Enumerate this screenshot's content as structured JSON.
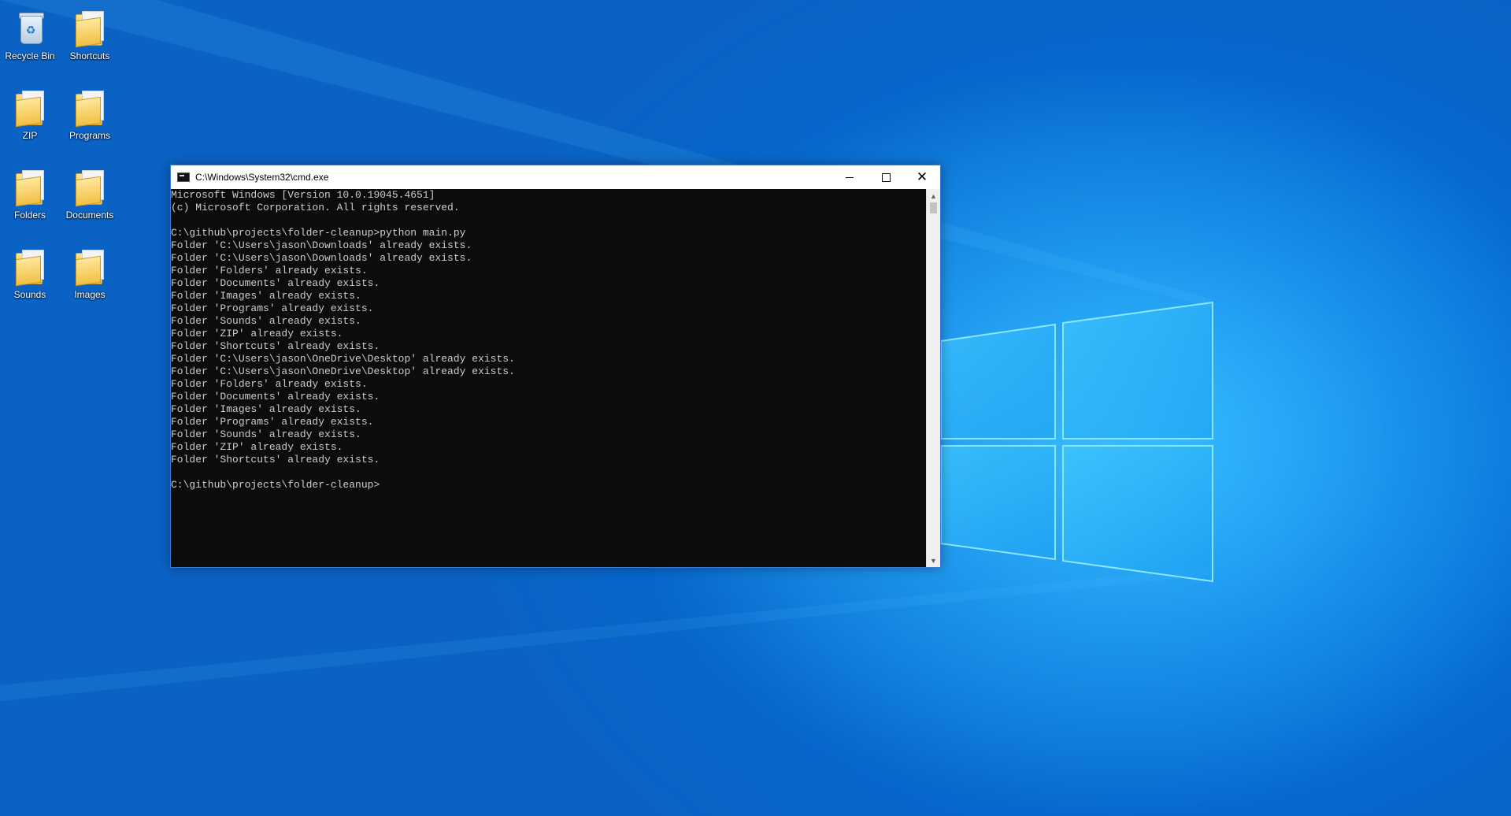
{
  "desktop": {
    "icons": [
      {
        "label": "Recycle Bin",
        "icon": "recycle-bin-icon"
      },
      {
        "label": "Shortcuts",
        "icon": "folder-icon"
      },
      {
        "label": "ZIP",
        "icon": "folder-icon"
      },
      {
        "label": "Programs",
        "icon": "folder-icon"
      },
      {
        "label": "Folders",
        "icon": "folder-icon"
      },
      {
        "label": "Documents",
        "icon": "folder-icon"
      },
      {
        "label": "Sounds",
        "icon": "folder-icon"
      },
      {
        "label": "Images",
        "icon": "folder-icon"
      }
    ]
  },
  "window": {
    "title": "C:\\Windows\\System32\\cmd.exe",
    "colors": {
      "console_bg": "#0c0c0c",
      "console_fg": "#cccccc",
      "titlebar_bg": "#ffffff"
    }
  },
  "console": {
    "lines": [
      "Microsoft Windows [Version 10.0.19045.4651]",
      "(c) Microsoft Corporation. All rights reserved.",
      "",
      "C:\\github\\projects\\folder-cleanup>python main.py",
      "Folder 'C:\\Users\\jason\\Downloads' already exists.",
      "Folder 'C:\\Users\\jason\\Downloads' already exists.",
      "Folder 'Folders' already exists.",
      "Folder 'Documents' already exists.",
      "Folder 'Images' already exists.",
      "Folder 'Programs' already exists.",
      "Folder 'Sounds' already exists.",
      "Folder 'ZIP' already exists.",
      "Folder 'Shortcuts' already exists.",
      "Folder 'C:\\Users\\jason\\OneDrive\\Desktop' already exists.",
      "Folder 'C:\\Users\\jason\\OneDrive\\Desktop' already exists.",
      "Folder 'Folders' already exists.",
      "Folder 'Documents' already exists.",
      "Folder 'Images' already exists.",
      "Folder 'Programs' already exists.",
      "Folder 'Sounds' already exists.",
      "Folder 'ZIP' already exists.",
      "Folder 'Shortcuts' already exists.",
      "",
      "C:\\github\\projects\\folder-cleanup>"
    ]
  }
}
